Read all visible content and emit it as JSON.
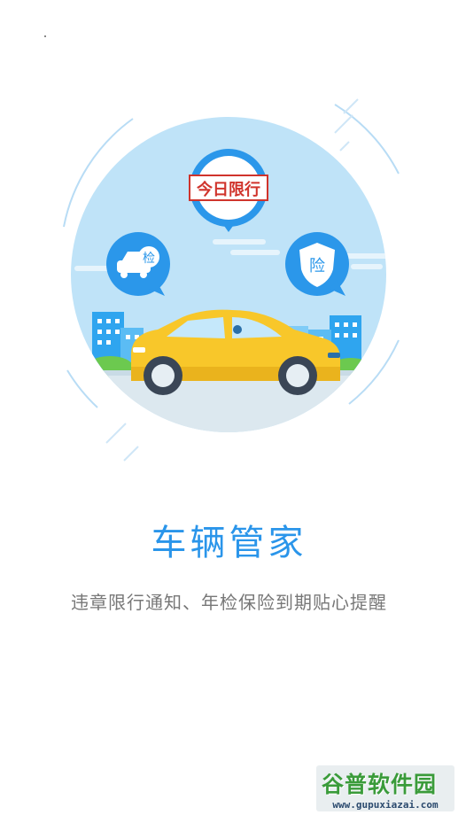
{
  "splash": {
    "bubble_restriction": "今日限行",
    "bubble_inspection": "检",
    "bubble_insurance": "险",
    "title": "车辆管家",
    "subtitle": "违章限行通知、年检保险到期贴心提醒"
  },
  "watermark": {
    "brand": "谷普软件园",
    "url": "www.gupuxiazai.com"
  },
  "colors": {
    "accent": "#2a95ea",
    "sky": "#b9e0f7",
    "car": "#f8c72a",
    "road": "#d9e6ee",
    "building": "#2fa5ef"
  }
}
